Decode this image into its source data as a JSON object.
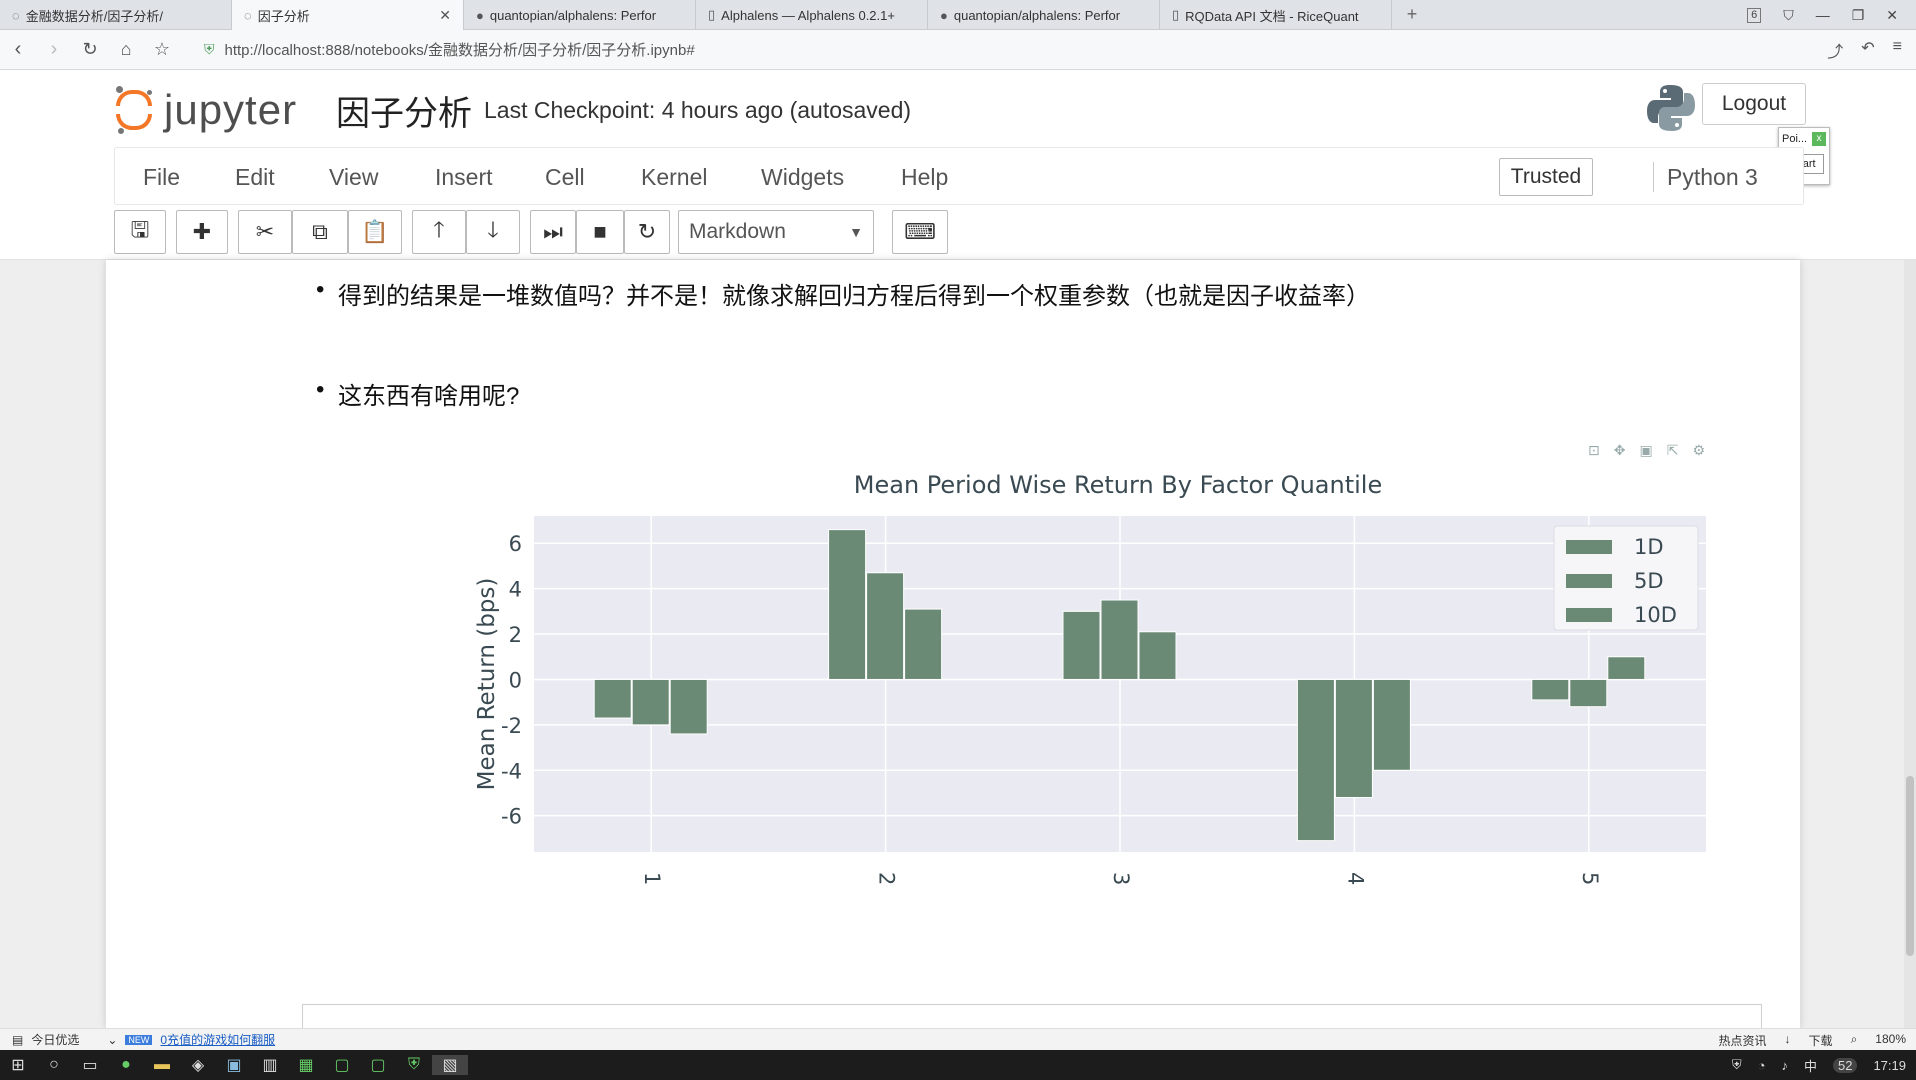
{
  "browser": {
    "tabs": [
      {
        "label": "金融数据分析/因子分析/",
        "icon": "loading-icon",
        "active": false
      },
      {
        "label": "因子分析",
        "icon": "loading-icon",
        "active": true
      },
      {
        "label": "quantopian/alphalens: Perfor",
        "icon": "github-icon",
        "active": false
      },
      {
        "label": "Alphalens — Alphalens 0.2.1+",
        "icon": "page-icon",
        "active": false
      },
      {
        "label": "quantopian/alphalens: Perfor",
        "icon": "github-icon",
        "active": false
      },
      {
        "label": "RQData API 文档 - RiceQuant",
        "icon": "page-icon",
        "active": false
      }
    ],
    "tab_count": "6",
    "url": "http://localhost:888/notebooks/金融数据分析/因子分析/因子分析.ipynb#"
  },
  "jupyter": {
    "logo_text": "jupyter",
    "notebook_title": "因子分析",
    "checkpoint": "Last Checkpoint: 4 hours ago (autosaved)",
    "logout": "Logout",
    "popup": {
      "title": "Poi...",
      "close": "x",
      "start": "Start"
    },
    "menu": [
      "File",
      "Edit",
      "View",
      "Insert",
      "Cell",
      "Kernel",
      "Widgets",
      "Help"
    ],
    "trusted": "Trusted",
    "kernel": "Python 3",
    "cell_type": "Markdown"
  },
  "notebook": {
    "bullets": [
      "得到的结果是一堆数值吗？并不是！就像求解回归方程后得到一个权重参数（也就是因子收益率）",
      "这东西有啥用呢?"
    ]
  },
  "chart_data": {
    "type": "bar",
    "title": "Mean Period Wise Return By Factor Quantile",
    "xlabel": "",
    "ylabel": "Mean Return (bps)",
    "categories": [
      "1",
      "2",
      "3",
      "4",
      "5"
    ],
    "series": [
      {
        "name": "1D",
        "values": [
          -1.7,
          6.6,
          3.0,
          -7.1,
          -0.9
        ]
      },
      {
        "name": "5D",
        "values": [
          -2.0,
          4.7,
          3.5,
          -5.2,
          -1.2
        ]
      },
      {
        "name": "10D",
        "values": [
          -2.4,
          3.1,
          2.1,
          -4.0,
          1.0
        ]
      }
    ],
    "ylim": [
      -7.6,
      7.2
    ],
    "yticks": [
      6,
      4,
      2,
      0,
      -2,
      -4,
      -6
    ],
    "grid": true,
    "legend": "top-right",
    "bar_color": "#6a8a75"
  },
  "status": {
    "left_label": "今日优选",
    "badge": "NEW",
    "link": "0充值的游戏如何翻服",
    "right_items": [
      "热点资讯",
      "下载",
      "180%"
    ]
  },
  "taskbar": {
    "clock": "17:19",
    "ime": "中",
    "badge_num": "52"
  }
}
